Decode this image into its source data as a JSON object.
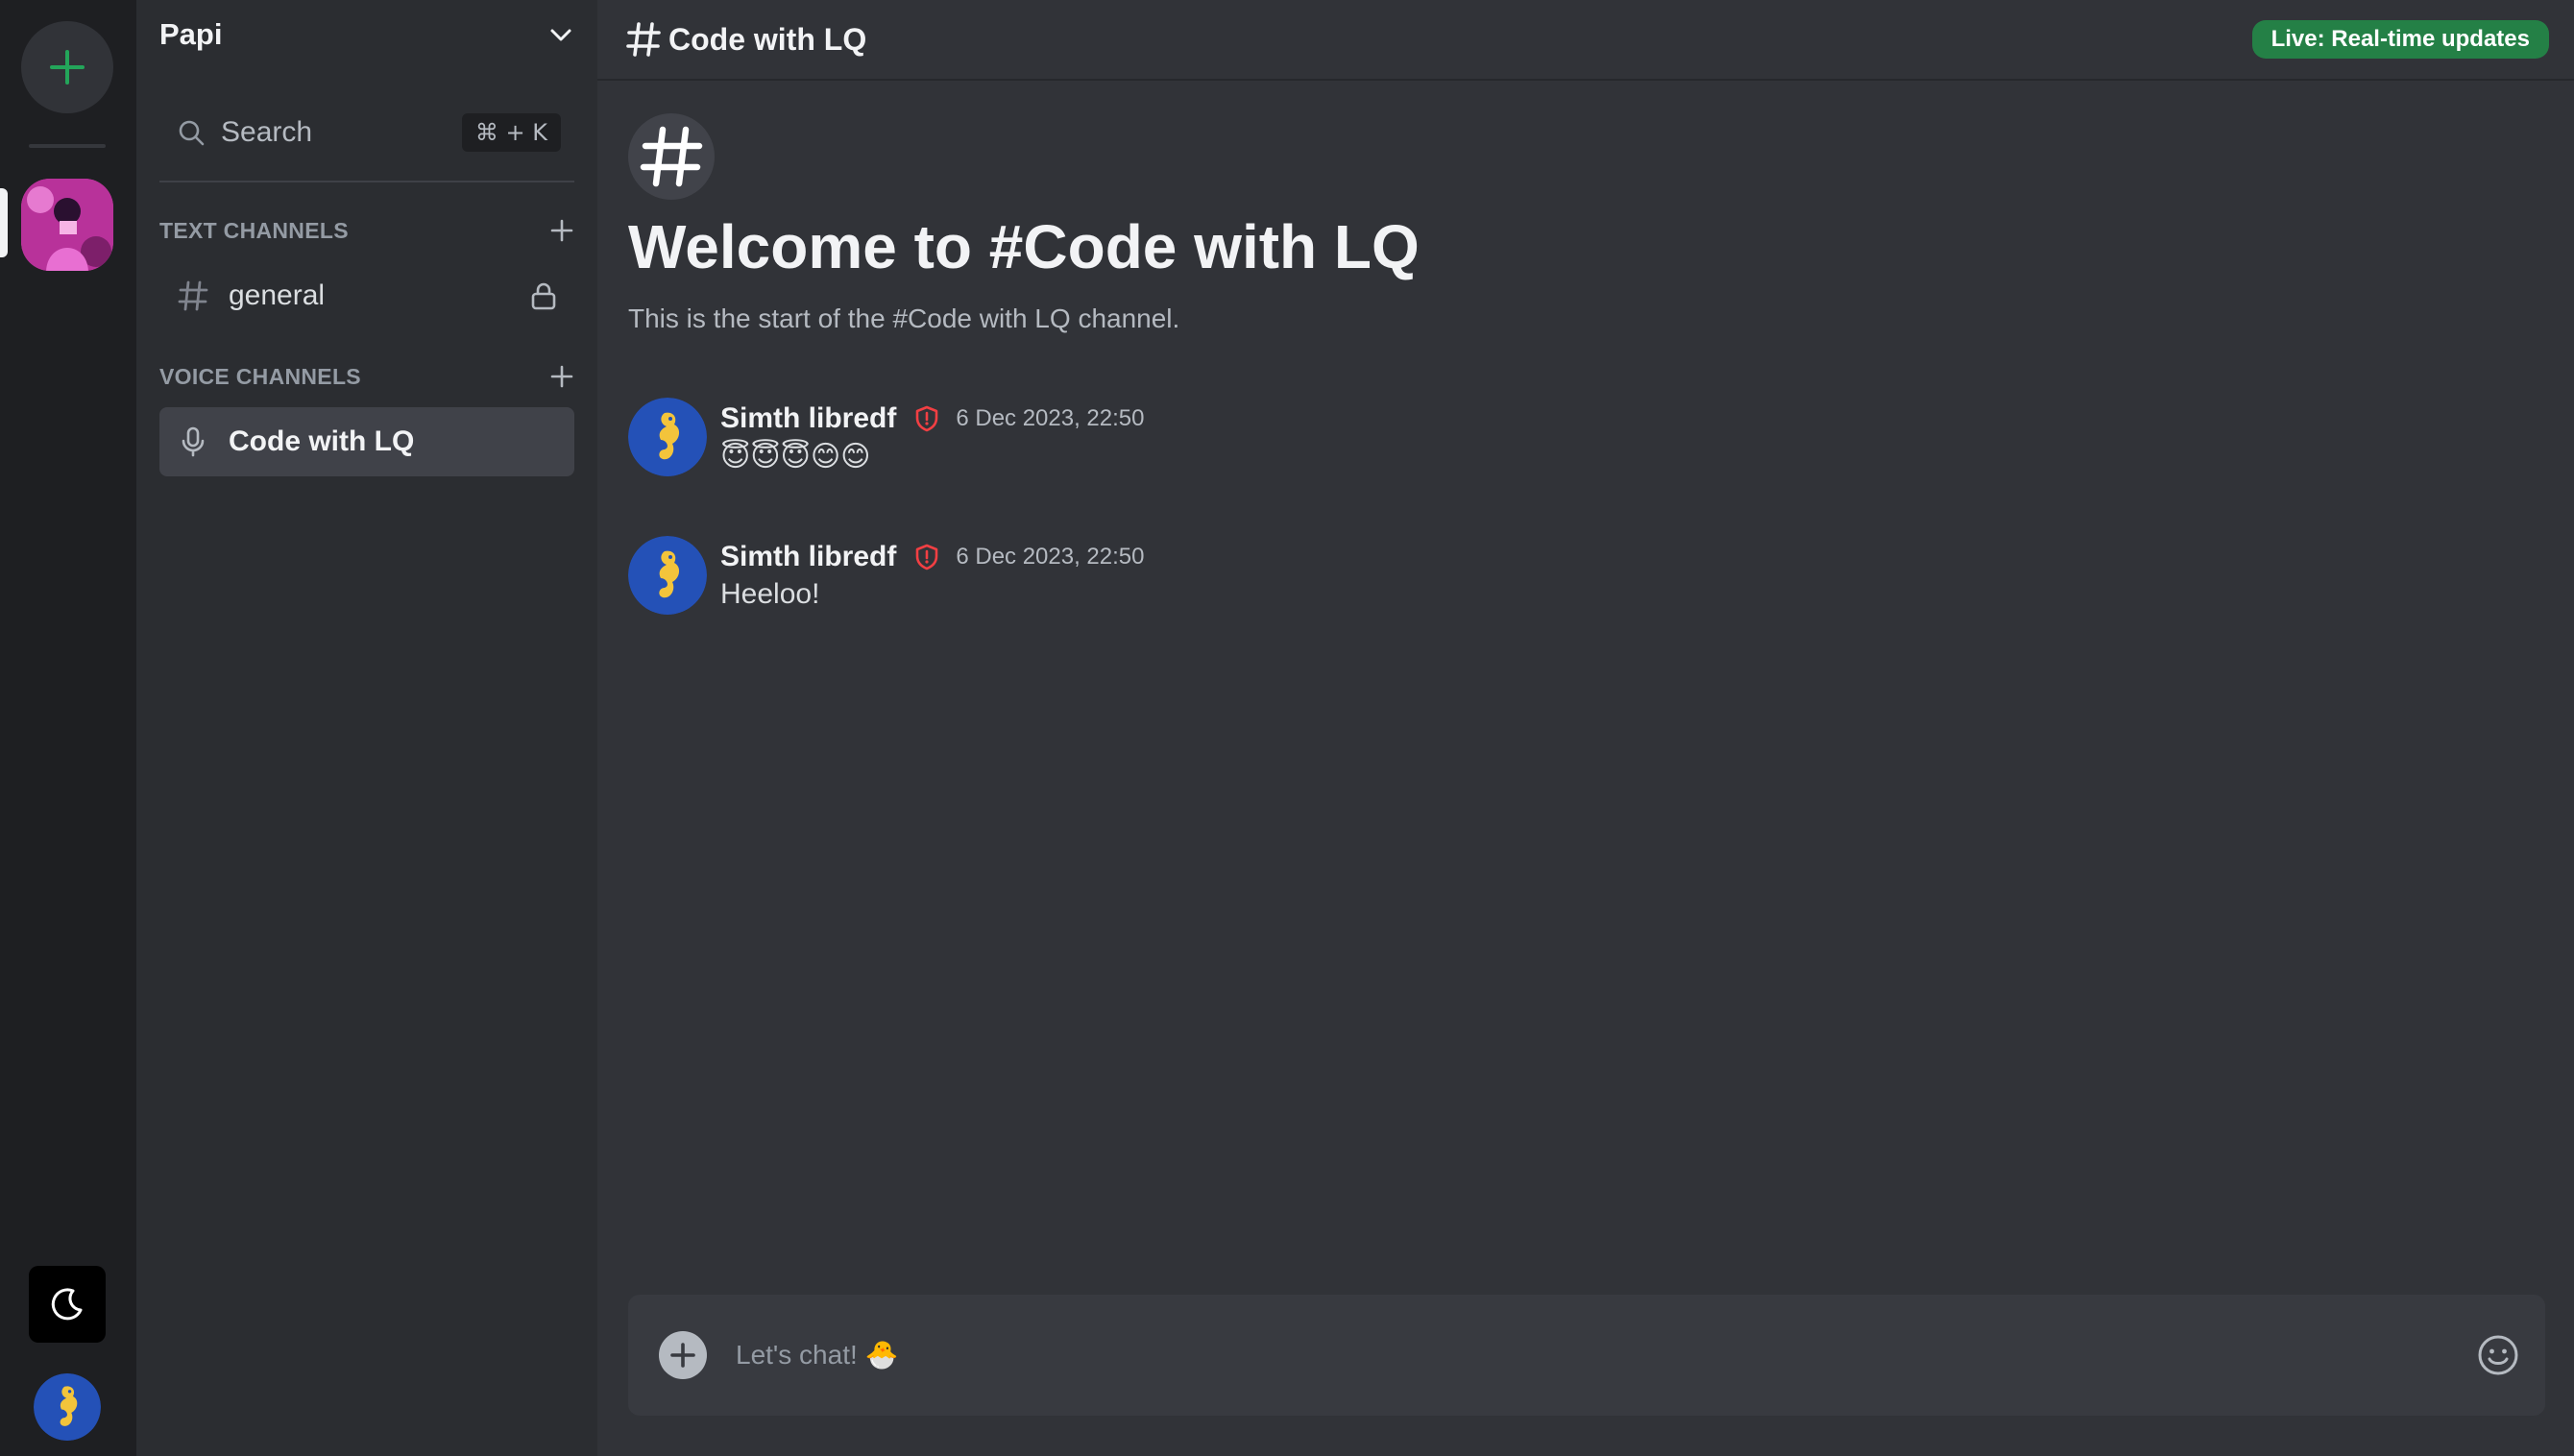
{
  "server": {
    "name": "Papi"
  },
  "search": {
    "label": "Search",
    "shortcut": "⌘ + K"
  },
  "categories": {
    "text": "TEXT CHANNELS",
    "voice": "VOICE CHANNELS"
  },
  "channels": {
    "text": [
      {
        "name": "general",
        "locked": true
      }
    ],
    "voice": [
      {
        "name": "Code with LQ",
        "active": true
      }
    ]
  },
  "topbar": {
    "channel_name": "Code with LQ",
    "live_badge": "Live: Real-time updates"
  },
  "welcome": {
    "title": "Welcome to #Code with LQ",
    "subtitle": "This is the start of the #Code with LQ channel."
  },
  "messages": [
    {
      "author": "Simth libredf",
      "timestamp": "6 Dec 2023, 22:50",
      "content": "😇😇😇😊😊"
    },
    {
      "author": "Simth libredf",
      "timestamp": "6 Dec 2023, 22:50",
      "content": "Heeloo!"
    }
  ],
  "composer": {
    "placeholder": "Let's chat! 🐣"
  },
  "icons": {
    "add_server": "plus-icon",
    "theme_toggle": "moon-icon",
    "search": "search-icon",
    "dropdown": "chevron-down-icon",
    "text_channel": "hash-icon",
    "lock": "lock-icon",
    "voice": "microphone-icon",
    "moderator": "shield-icon",
    "composer_add": "plus-circle-icon",
    "emoji": "smiley-icon"
  },
  "colors": {
    "accent_green": "#23a55a",
    "moderator_red": "#f23f43",
    "background": "#313338",
    "sidebar": "#2b2d31",
    "rail": "#1e1f22"
  }
}
